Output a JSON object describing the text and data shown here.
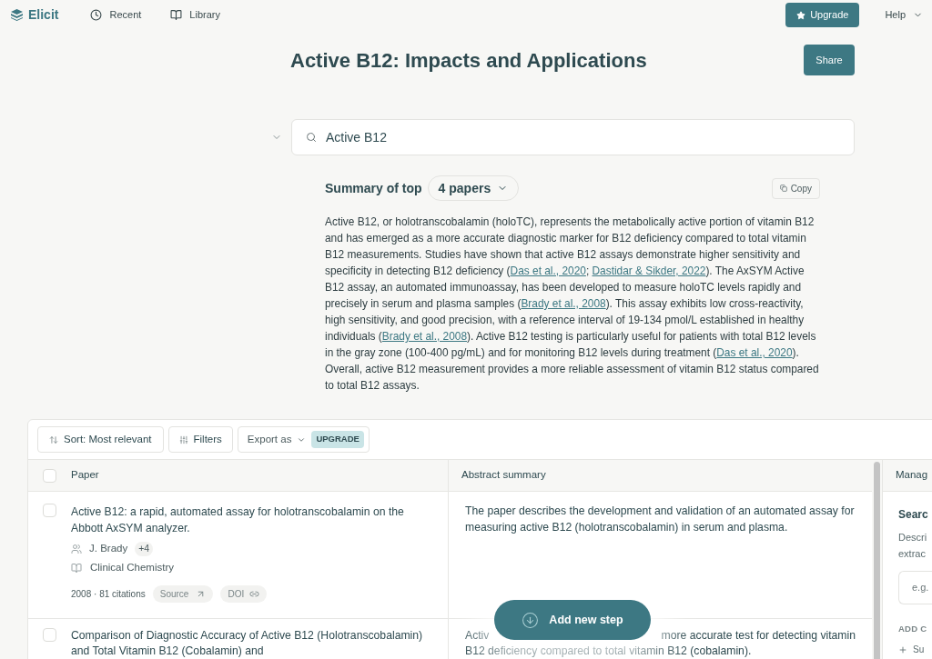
{
  "nav": {
    "logo": "Elicit",
    "items": [
      {
        "label": "Recent"
      },
      {
        "label": "Library"
      }
    ],
    "upgrade": "Upgrade",
    "help": "Help"
  },
  "title": "Active B12: Impacts and Applications",
  "share": "Share",
  "query": {
    "value": "Active B12",
    "expanded": false
  },
  "summary": {
    "heading": "Summary of top",
    "papers_select": "4 papers",
    "copy": "Copy",
    "segments": [
      {
        "kind": "text",
        "text": "Active B12, or holotranscobalamin (holoTC), represents the metabolically active portion of vitamin B12 and has emerged as a more accurate diagnostic marker for B12 deficiency compared to total vitamin B12 measurements. Studies have shown that active B12 assays demonstrate higher sensitivity and specificity in detecting B12 deficiency ("
      },
      {
        "kind": "link",
        "text": "Das et al., 2020"
      },
      {
        "kind": "text",
        "text": "; "
      },
      {
        "kind": "link",
        "text": "Dastidar & Sikder, 2022"
      },
      {
        "kind": "text",
        "text": "). The AxSYM Active B12 assay, an automated immunoassay, has been developed to measure holoTC levels rapidly and precisely in serum and plasma samples ("
      },
      {
        "kind": "link",
        "text": "Brady et al., 2008"
      },
      {
        "kind": "text",
        "text": "). This assay exhibits low cross-reactivity, high sensitivity, and good precision, with a reference interval of 19-134 pmol/L established in healthy individuals ("
      },
      {
        "kind": "link",
        "text": "Brady et al., 2008"
      },
      {
        "kind": "text",
        "text": "). Active B12 testing is particularly useful for patients with total B12 levels in the gray zone (100-400 pg/mL) and for monitoring B12 levels during treatment ("
      },
      {
        "kind": "link",
        "text": "Das et al., 2020"
      },
      {
        "kind": "text",
        "text": "). Overall, active B12 measurement provides a more reliable assessment of vitamin B12 status compared to total B12 assays."
      }
    ]
  },
  "toolbar": {
    "sort": "Sort: Most relevant",
    "filters": "Filters",
    "export": "Export as",
    "badge": "UPGRADE"
  },
  "table": {
    "checked": false,
    "columns": [
      "Paper",
      "Abstract summary"
    ],
    "rows": [
      {
        "checked": false,
        "title": "Active B12: a rapid, automated assay for holotranscobalamin on the Abbott AxSYM analyzer.",
        "author": "J. Brady",
        "more_authors": "+4",
        "journal": "Clinical Chemistry",
        "meta": "2008 · 81 citations",
        "source": "Source",
        "doi": "DOI",
        "abstract": "The paper describes the development and validation of an automated assay for measuring active B12 (holotranscobalamin) in serum and plasma."
      },
      {
        "checked": false,
        "title": "Comparison of Diagnostic Accuracy of Active B12 (Holotranscobalamin) and Total Vitamin B12 (Cobalamin) and",
        "abstract_lines": [
          [
            "Activ",
            "more accurate test for detecting vitamin"
          ],
          [
            "B12 deficiency compared to total vitamin B12 (cobalamin)."
          ]
        ]
      }
    ]
  },
  "side_panel": {
    "title": "Manag",
    "heading": "Searc",
    "description": [
      "Descri",
      "extrac"
    ],
    "placeholder": "e.g.",
    "section": "ADD C",
    "add_item": "Su"
  },
  "fab": "Add new step"
}
